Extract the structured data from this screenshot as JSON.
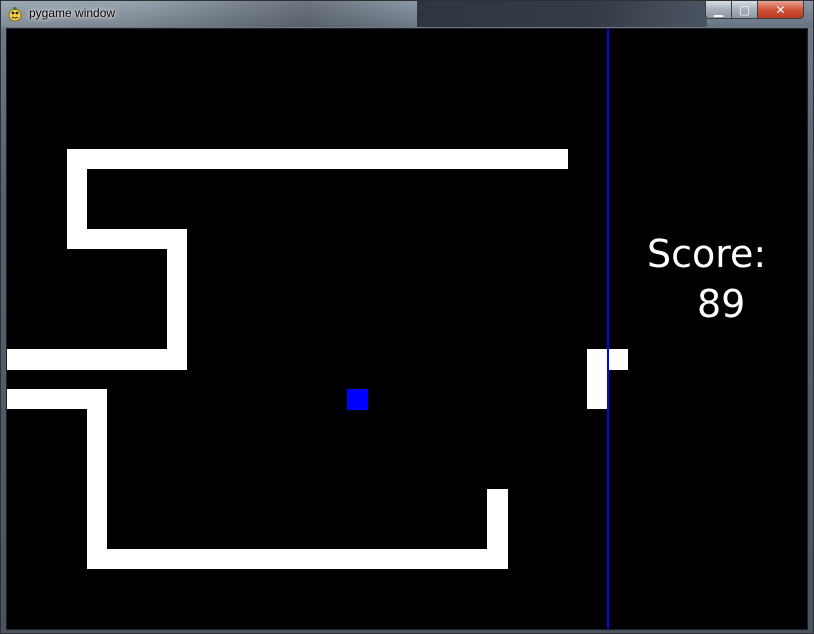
{
  "window": {
    "title": "pygame window",
    "icon": "pygame-snake-icon",
    "controls": {
      "minimize_icon": "minimize-icon",
      "maximize_icon": "maximize-icon",
      "close_icon": "close-icon",
      "minimize_glyph": "▁",
      "maximize_glyph": "▢",
      "close_glyph": "✕"
    }
  },
  "game": {
    "score_label": "Score:",
    "score_value": "89",
    "colors": {
      "background": "#000000",
      "snake": "#ffffff",
      "food": "#0000ff",
      "divider": "#0000ff",
      "text": "#ffffff"
    }
  }
}
